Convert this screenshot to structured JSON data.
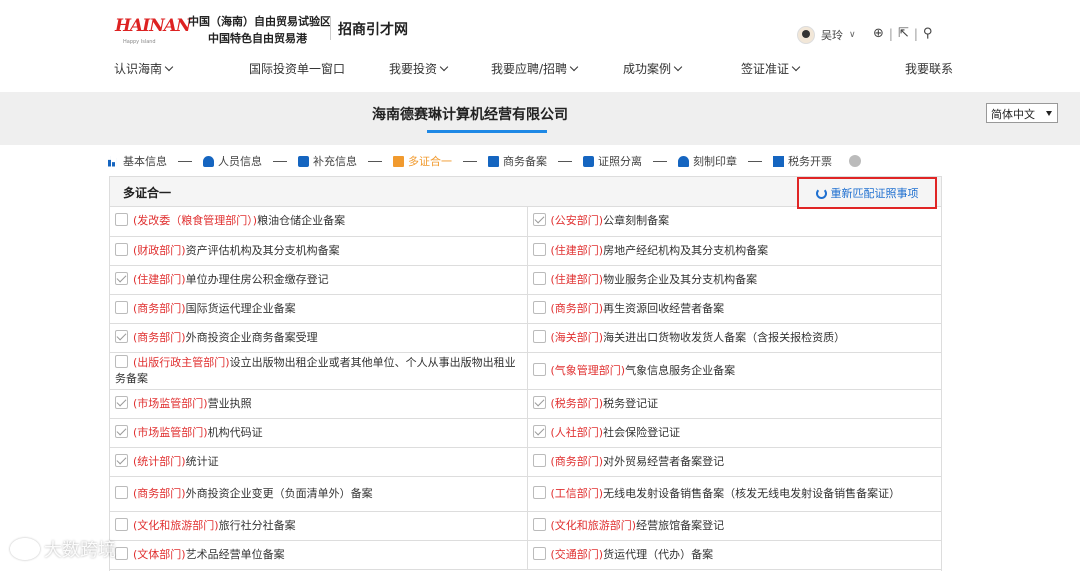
{
  "header": {
    "logo_text": "HAINAN",
    "logo_sub": "Happy Island",
    "zone_line1": "中国（海南）自由贸易试验区",
    "zone_line2": "中国特色自由贸易港",
    "site_title": "招商引才网",
    "user_name": "吴玲",
    "tools": [
      "⊕",
      "|",
      "⇱",
      "|",
      "⚲"
    ]
  },
  "nav": [
    "认识海南",
    "国际投资单一窗口",
    "我要投资",
    "我要应聘/招聘",
    "成功案例",
    "签证准证",
    "我要联系"
  ],
  "company": {
    "name": "海南德赛琳计算机经营有限公司"
  },
  "language": {
    "selected": "简体中文"
  },
  "steps": [
    "基本信息",
    "人员信息",
    "补充信息",
    "多证合一",
    "商务备案",
    "证照分离",
    "刻制印章",
    "税务开票"
  ],
  "active_step": "多证合一",
  "panel": {
    "title": "多证合一",
    "rematch_label": "重新匹配证照事项"
  },
  "rows": [
    [
      {
        "checked": false,
        "dept": "(发改委（粮食管理部门）)",
        "text": "粮油仓储企业备案"
      },
      {
        "checked": true,
        "dept": "(公安部门)",
        "text": "公章刻制备案"
      }
    ],
    [
      {
        "checked": false,
        "dept": "(财政部门)",
        "text": "资产评估机构及其分支机构备案"
      },
      {
        "checked": false,
        "dept": "(住建部门)",
        "text": "房地产经纪机构及其分支机构备案"
      }
    ],
    [
      {
        "checked": true,
        "dept": "(住建部门)",
        "text": "单位办理住房公积金缴存登记"
      },
      {
        "checked": false,
        "dept": "(住建部门)",
        "text": "物业服务企业及其分支机构备案"
      }
    ],
    [
      {
        "checked": false,
        "dept": "(商务部门)",
        "text": "国际货运代理企业备案"
      },
      {
        "checked": false,
        "dept": "(商务部门)",
        "text": "再生资源回收经营者备案"
      }
    ],
    [
      {
        "checked": true,
        "dept": "(商务部门)",
        "text": "外商投资企业商务备案受理"
      },
      {
        "checked": false,
        "dept": "(海关部门)",
        "text": "海关进出口货物收发货人备案（含报关报检资质）"
      }
    ],
    [
      {
        "checked": false,
        "dept": "(出版行政主管部门)",
        "text": "设立出版物出租企业或者其他单位、个人从事出版物出租业务备案"
      },
      {
        "checked": false,
        "dept": "(气象管理部门)",
        "text": "气象信息服务企业备案"
      }
    ],
    [
      {
        "checked": true,
        "dept": "(市场监管部门)",
        "text": "营业执照"
      },
      {
        "checked": true,
        "dept": "(税务部门)",
        "text": "税务登记证"
      }
    ],
    [
      {
        "checked": true,
        "dept": "(市场监管部门)",
        "text": "机构代码证"
      },
      {
        "checked": true,
        "dept": "(人社部门)",
        "text": "社会保险登记证"
      }
    ],
    [
      {
        "checked": true,
        "dept": "(统计部门)",
        "text": "统计证"
      },
      {
        "checked": false,
        "dept": "(商务部门)",
        "text": "对外贸易经营者备案登记"
      }
    ],
    [
      {
        "checked": false,
        "dept": "(商务部门)",
        "text": "外商投资企业变更（负面清单外）备案"
      },
      {
        "checked": false,
        "dept": "(工信部门)",
        "text": "无线电发射设备销售备案（核发无线电发射设备销售备案证）"
      }
    ],
    [
      {
        "checked": false,
        "dept": "(文化和旅游部门)",
        "text": "旅行社分社备案"
      },
      {
        "checked": false,
        "dept": "(文化和旅游部门)",
        "text": "经营旅馆备案登记"
      }
    ],
    [
      {
        "checked": false,
        "dept": "(文体部门)",
        "text": "艺术品经营单位备案"
      },
      {
        "checked": false,
        "dept": "(交通部门)",
        "text": "货运代理（代办）备案"
      }
    ]
  ],
  "watermark": "大数跨境"
}
